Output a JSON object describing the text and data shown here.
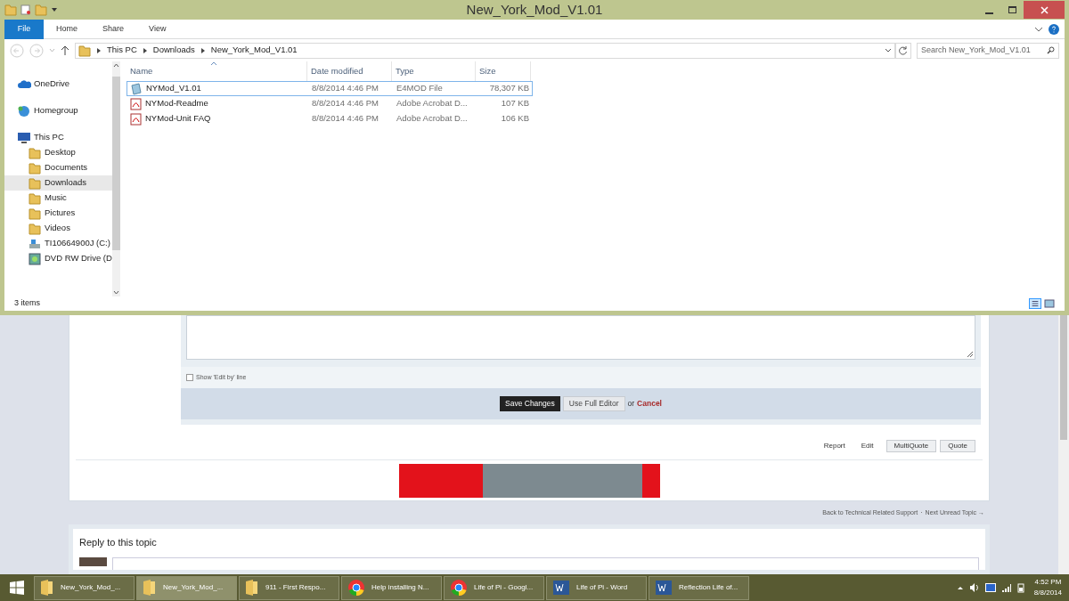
{
  "window": {
    "title": "New_York_Mod_V1.01"
  },
  "ribbon_tabs": [
    {
      "label": "File",
      "selected": true
    },
    {
      "label": "Home",
      "selected": false
    },
    {
      "label": "Share",
      "selected": false
    },
    {
      "label": "View",
      "selected": false
    }
  ],
  "breadcrumbs": [
    "This PC",
    "Downloads",
    "New_York_Mod_V1.01"
  ],
  "search": {
    "placeholder": "Search New_York_Mod_V1.01"
  },
  "sidebar": {
    "items": [
      {
        "label": "OneDrive",
        "kind": "cloud",
        "selected": false
      },
      {
        "label": "Homegroup",
        "kind": "homegroup",
        "selected": false
      },
      {
        "label": "This PC",
        "kind": "pc",
        "selected": false,
        "children": [
          {
            "label": "Desktop",
            "kind": "folder",
            "selected": false
          },
          {
            "label": "Documents",
            "kind": "folder",
            "selected": false
          },
          {
            "label": "Downloads",
            "kind": "folder",
            "selected": true
          },
          {
            "label": "Music",
            "kind": "folder",
            "selected": false
          },
          {
            "label": "Pictures",
            "kind": "folder",
            "selected": false
          },
          {
            "label": "Videos",
            "kind": "folder",
            "selected": false
          },
          {
            "label": "TI10664900J (C:)",
            "kind": "drive",
            "selected": false
          },
          {
            "label": "DVD RW Drive (D",
            "kind": "dvd",
            "selected": false
          }
        ]
      }
    ]
  },
  "table": {
    "columns": [
      "Name",
      "Date modified",
      "Type",
      "Size"
    ],
    "rows": [
      {
        "name": "NYMod_V1.01",
        "date": "8/8/2014 4:46 PM",
        "type": "E4MOD File",
        "size": "78,307 KB",
        "kind": "file",
        "selected": true
      },
      {
        "name": "NYMod-Readme",
        "date": "8/8/2014 4:46 PM",
        "type": "Adobe Acrobat D...",
        "size": "107 KB",
        "kind": "pdf",
        "selected": false
      },
      {
        "name": "NYMod-Unit FAQ",
        "date": "8/8/2014 4:46 PM",
        "type": "Adobe Acrobat D...",
        "size": "106 KB",
        "kind": "pdf",
        "selected": false
      }
    ]
  },
  "status_bar": "3 items",
  "forum": {
    "edit_by_label": "Show 'Edit by' line",
    "edit_by_checked": false,
    "save": "Save Changes",
    "full_editor": "Use Full Editor",
    "or": "or",
    "cancel": "Cancel",
    "post_actions": [
      "Report",
      "Edit"
    ],
    "post_buttons": [
      "MultiQuote",
      "Quote"
    ],
    "back_link": "Back to Technical Related Support",
    "separator": "·",
    "next_link": "Next Unread Topic →",
    "reply_title": "Reply to this topic"
  },
  "taskbar": {
    "items": [
      {
        "label": "New_York_Mod_...",
        "kind": "folder",
        "selected": false
      },
      {
        "label": "New_York_Mod_...",
        "kind": "folder",
        "selected": true
      },
      {
        "label": "911 - First Respo...",
        "kind": "folder",
        "selected": false
      },
      {
        "label": "Help installing N...",
        "kind": "chrome",
        "selected": false
      },
      {
        "label": "Life of Pi - Googl...",
        "kind": "chrome",
        "selected": false
      },
      {
        "label": "Life of Pi - Word",
        "kind": "word",
        "selected": false
      },
      {
        "label": "Reflection Life of...",
        "kind": "word",
        "selected": false
      }
    ],
    "time": "4:52 PM",
    "date": "8/8/2014"
  }
}
